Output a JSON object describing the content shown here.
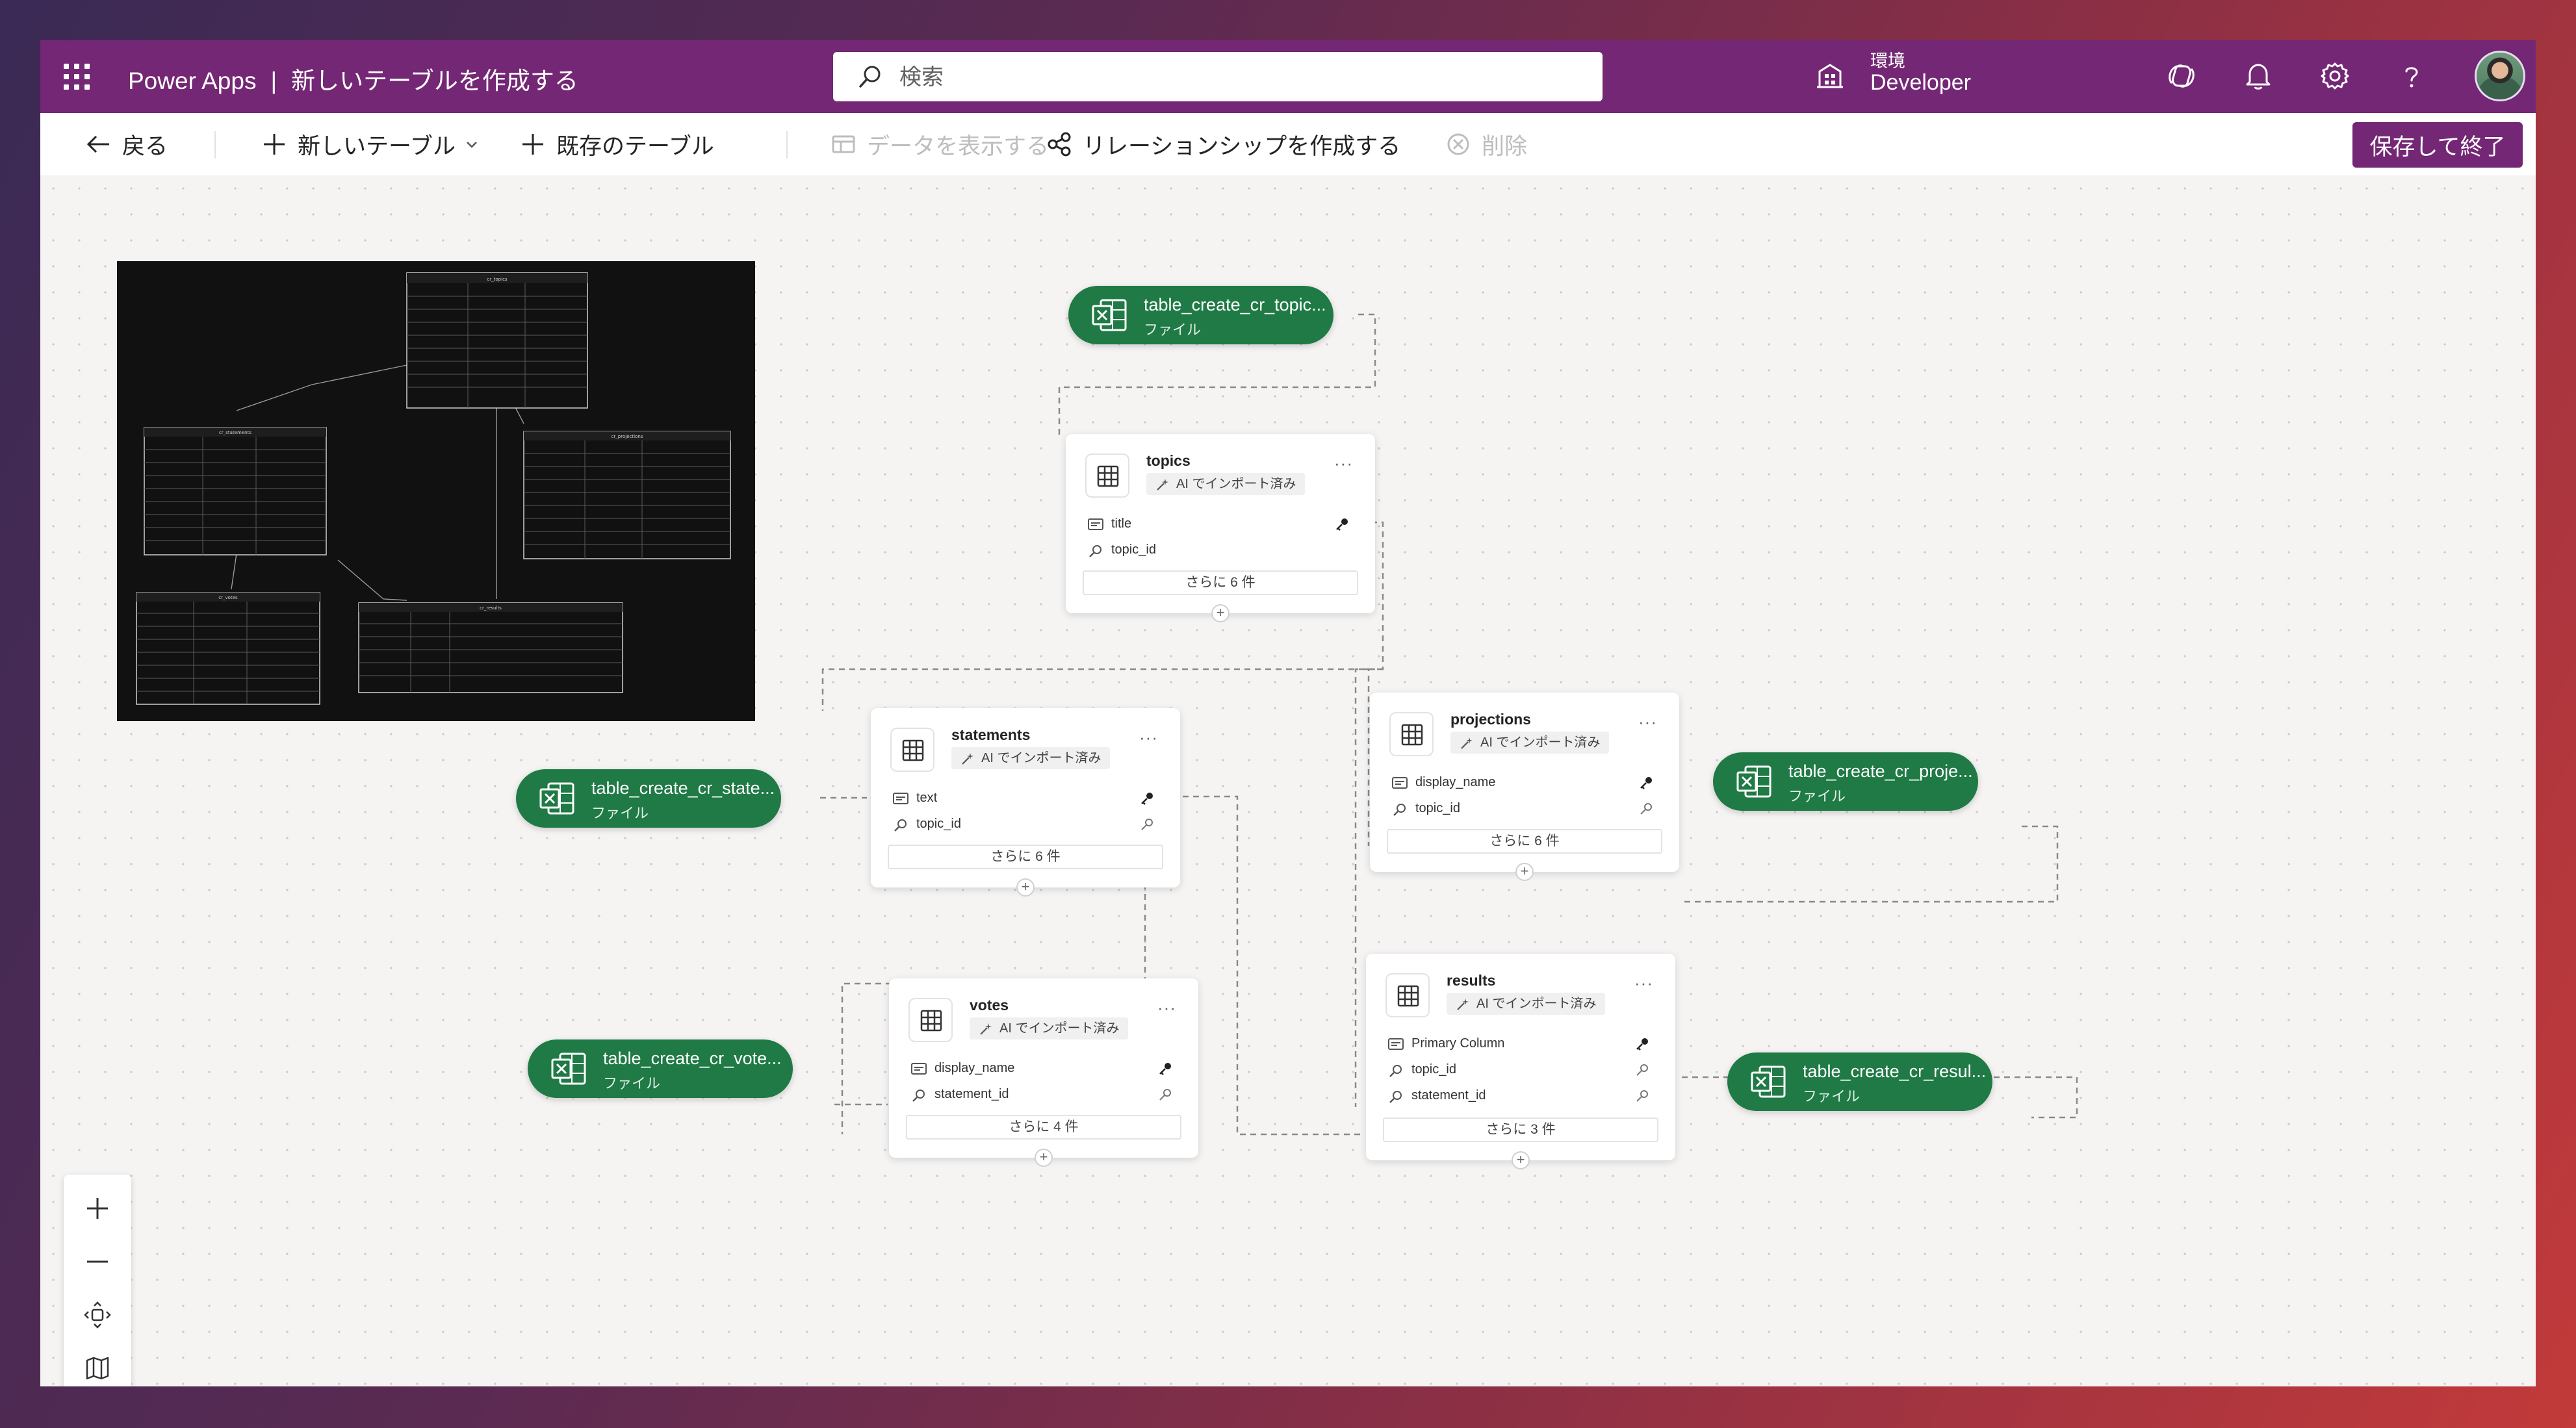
{
  "app": {
    "name": "Power Apps",
    "separator": "|",
    "page_title": "新しいテーブルを作成する"
  },
  "search": {
    "placeholder": "検索"
  },
  "environment": {
    "label": "環境",
    "name": "Developer"
  },
  "toolbar": {
    "back": "戻る",
    "new_table": "新しいテーブル",
    "existing_table": "既存のテーブル",
    "view_data": "データを表示する",
    "create_relationship": "リレーションシップを作成する",
    "delete": "削除",
    "save_exit": "保存して終了"
  },
  "erd_image": {
    "tables": [
      "cr_topics",
      "cr_statements",
      "cr_projections",
      "cr_votes",
      "cr_results"
    ]
  },
  "files": [
    {
      "name": "table_create_cr_topic...",
      "type": "ファイル"
    },
    {
      "name": "table_create_cr_state...",
      "type": "ファイル"
    },
    {
      "name": "table_create_cr_proje...",
      "type": "ファイル"
    },
    {
      "name": "table_create_cr_vote...",
      "type": "ファイル"
    },
    {
      "name": "table_create_cr_resul...",
      "type": "ファイル"
    }
  ],
  "tables": [
    {
      "name": "topics",
      "badge": "AI でインポート済み",
      "fields": [
        "title",
        "topic_id"
      ],
      "more": "さらに 6 件"
    },
    {
      "name": "statements",
      "badge": "AI でインポート済み",
      "fields": [
        "text",
        "topic_id"
      ],
      "more": "さらに 6 件"
    },
    {
      "name": "projections",
      "badge": "AI でインポート済み",
      "fields": [
        "display_name",
        "topic_id"
      ],
      "more": "さらに 6 件"
    },
    {
      "name": "votes",
      "badge": "AI でインポート済み",
      "fields": [
        "display_name",
        "statement_id"
      ],
      "more": "さらに 4 件"
    },
    {
      "name": "results",
      "badge": "AI でインポート済み",
      "fields": [
        "Primary Column",
        "topic_id",
        "statement_id"
      ],
      "more": "さらに 3 件"
    }
  ],
  "colors": {
    "topbar": "#742774",
    "file_pill": "#1f7a45",
    "save_button": "#742774"
  }
}
